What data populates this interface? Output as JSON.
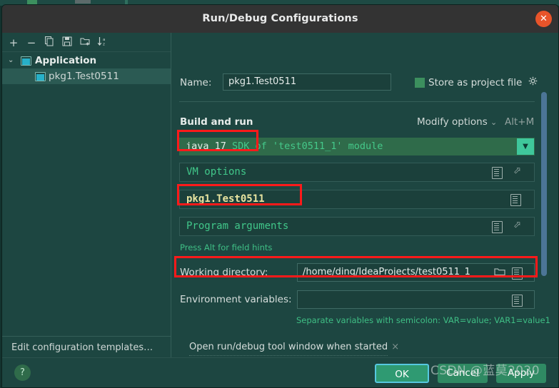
{
  "window": {
    "title": "Run/Debug Configurations",
    "close_icon": "close-icon"
  },
  "toolbar": {
    "icons": [
      {
        "name": "add-icon",
        "glyph": "+"
      },
      {
        "name": "remove-icon",
        "glyph": "−"
      },
      {
        "name": "copy-icon",
        "glyph": "⎘"
      },
      {
        "name": "save-icon",
        "glyph": "💾"
      },
      {
        "name": "new-folder-icon",
        "glyph": "🗀"
      },
      {
        "name": "sort-alphabetically-icon",
        "glyph": "↓"
      }
    ]
  },
  "sidebar": {
    "group_label": "Application",
    "twisty": "⌄",
    "items": [
      {
        "label": "pkg1.Test0511",
        "selected": true
      }
    ],
    "edit_templates_label": "Edit configuration templates…"
  },
  "form": {
    "name_label": "Name:",
    "name_value": "pkg1.Test0511",
    "store_as_project_file_label": "Store as project file",
    "store_gear_icon": "gear-icon",
    "section_title": "Build and run",
    "modify_options_label": "Modify options",
    "modify_options_chevron": "⌄",
    "modify_options_shortcut": "Alt+M",
    "jdk_text_prefix": "java 17 ",
    "jdk_text_suffix": "SDK of 'test0511_1' module",
    "jdk_arrow": "▼",
    "vm_options_placeholder": "VM options",
    "main_class_value": "pkg1.Test0511",
    "program_arguments_placeholder": "Program arguments",
    "field_hints": "Press Alt for field hints",
    "working_directory_label": "Working directory:",
    "working_directory_value": "/home/ding/IdeaProjects/test0511_1",
    "environment_variables_label": "Environment variables:",
    "environment_variables_value": "",
    "env_hint": "Separate variables with semicolon: VAR=value; VAR1=value1",
    "open_tool_window_label": "Open run/debug tool window when started",
    "open_tool_window_remove": "×"
  },
  "footer": {
    "help_label": "?",
    "ok_label": "OK",
    "cancel_label": "Cancel",
    "apply_label": "Apply"
  },
  "watermark": {
    "text": "CSDN @蓝莫2020"
  },
  "colors": {
    "dialog_bg": "#1d4641",
    "titlebar_bg": "#333333",
    "close_btn": "#e8542a",
    "accent_green": "#3fc79b",
    "annotation_red": "#ff1a1a",
    "scrollbar_blue": "#4c7596",
    "hint_green": "#3fbf85",
    "ok_border": "#56c8e0"
  }
}
